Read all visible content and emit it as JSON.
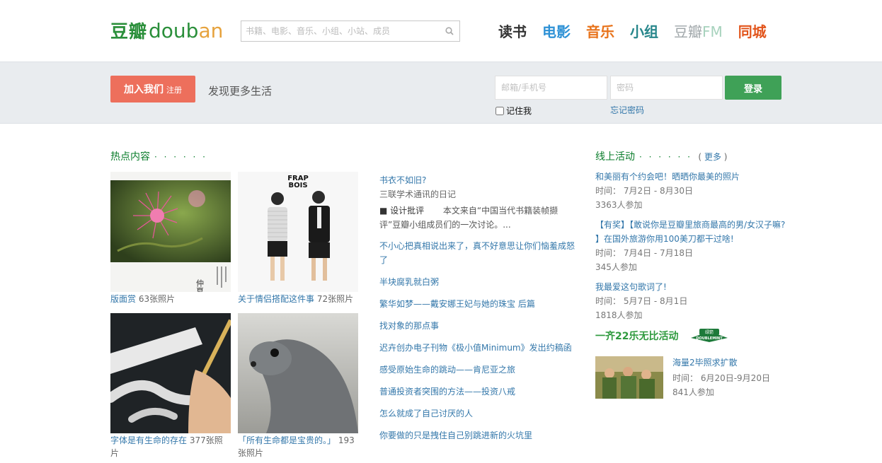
{
  "header": {
    "logo_cn": "豆瓣",
    "logo_en_left": "doub",
    "logo_en_right": "an",
    "search_placeholder": "书籍、电影、音乐、小组、小站、成员",
    "nav": {
      "book": "读书",
      "movie": "电影",
      "music": "音乐",
      "group": "小组",
      "fm_cn": "豆瓣",
      "fm_en": "FM",
      "city": "同城"
    }
  },
  "band": {
    "join_label": "加入我们",
    "join_small": "注册",
    "slogan": "发现更多生活",
    "email_placeholder": "邮箱/手机号",
    "password_placeholder": "密码",
    "login_label": "登录",
    "remember_label": "记住我",
    "forgot_label": "忘记密码"
  },
  "hot": {
    "title": "热点内容",
    "dots": "· · · · · ·",
    "photos": [
      {
        "title": "版面赏",
        "count": "63张照片"
      },
      {
        "title": "关于情侣搭配这件事",
        "count": "72张照片"
      },
      {
        "title": "字体是有生命的存在",
        "count": "377张照片"
      },
      {
        "title": "「所有生命都是宝贵的。」",
        "count": "193张照片"
      }
    ],
    "first_article": {
      "title": "书衣不如旧?",
      "subtitle": "三联学术通讯的日记",
      "tag": "■ 设计批评",
      "desc": "本文来自“中国当代书籍装帧撷评”豆瓣小组成员们的一次讨论。..."
    },
    "articles": [
      "不小心把真相说出来了，真不好意思让你们恼羞成怒了",
      "半块腐乳就白粥",
      "繁华如梦——戴安娜王妃与她的珠宝 后篇",
      "找对象的那点事",
      "迟卉创办电子刊物《极小值Minimum》发出约稿函",
      "感受原始生命的跳动——肯尼亚之旅",
      "普通投资者突围的方法——投资八戒",
      "怎么就成了自己讨厌的人",
      "你要做的只是拽住自己别跳进新的火坑里"
    ],
    "photo_texts": {
      "frap": "FRAP",
      "bois": "BOIS",
      "poster_text": "仲夏合欢"
    }
  },
  "online": {
    "title": "线上活动",
    "dots": "· · · · · ·",
    "more_open": "(",
    "more": "更多",
    "more_close": ")",
    "activities": [
      {
        "title": "和美丽有个约会吧！晒晒你最美的照片",
        "time": "时间： 7月2日 - 8月30日",
        "count": "3363人参加"
      },
      {
        "title": "【有奖】【敢说你是豆瓣里旅商最高的男/女汉子嘛? 】在国外旅游你用100美刀都干过啥!",
        "time": "时间： 7月4日 - 7月18日",
        "count": "345人参加"
      },
      {
        "title": "我最爱这句歌词了!",
        "time": "时间： 5月7日 - 8月1日",
        "count": "1818人参加"
      }
    ],
    "promo_title": "一齐22乐无比活动",
    "brand": "DOUBLEMINT",
    "brand_cn": "绿箭",
    "promo_item": {
      "title": "海量2毕照求扩散",
      "time": "时间： 6月20日-9月20日",
      "count": "841人参加"
    }
  }
}
